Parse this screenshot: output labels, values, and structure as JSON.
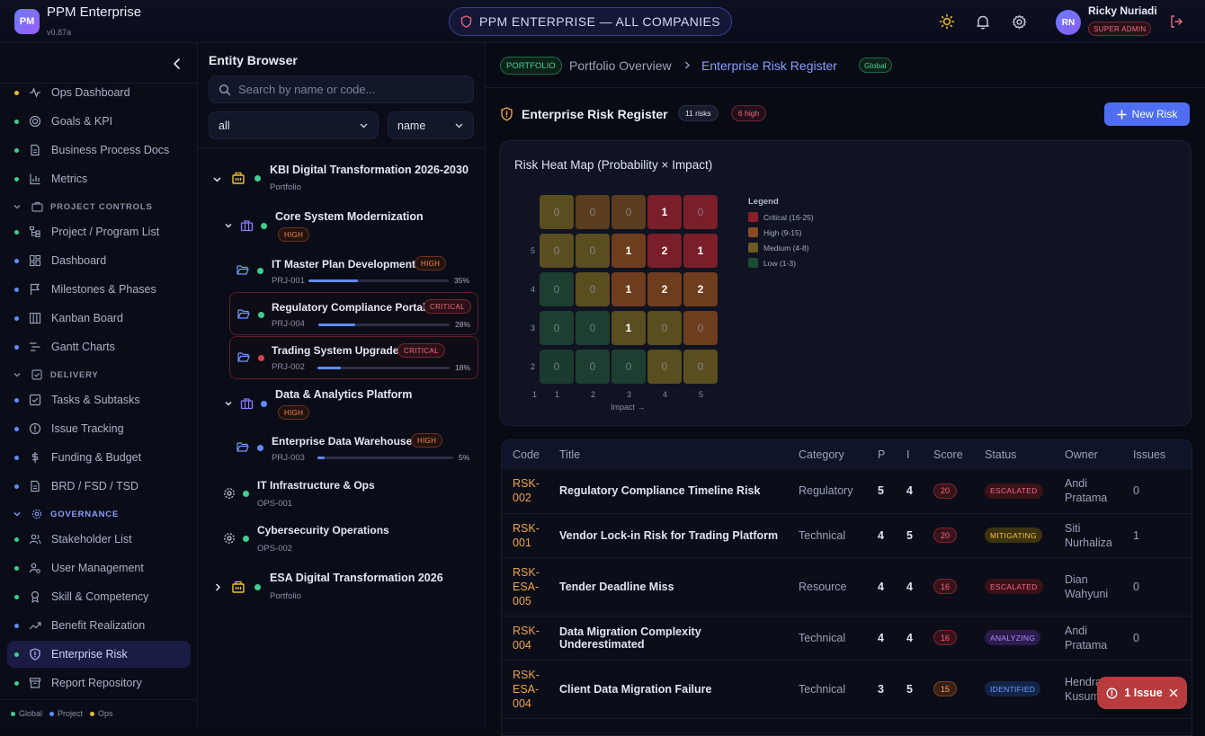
{
  "app": {
    "logo_text": "PM",
    "name": "PPM Enterprise",
    "version": "v0.87a"
  },
  "header": {
    "scope_label": "PPM ENTERPRISE — ALL COMPANIES",
    "user_initials": "RN",
    "user_name": "Ricky Nuriadi",
    "user_role": "SUPER ADMIN"
  },
  "sidebar": {
    "items": [
      {
        "label": "Ops Dashboard",
        "dot": "#e8b93b"
      },
      {
        "label": "Goals & KPI",
        "dot": "#3ecf8e"
      },
      {
        "label": "Business Process Docs",
        "dot": "#3ecf8e"
      },
      {
        "label": "Metrics",
        "dot": "#3ecf8e"
      }
    ],
    "sections": [
      {
        "label": "PROJECT CONTROLS"
      },
      {
        "label": "DELIVERY"
      },
      {
        "label": "GOVERNANCE"
      }
    ],
    "project_items": [
      {
        "label": "Project / Program List",
        "dot": "#3ecf8e"
      },
      {
        "label": "Dashboard",
        "dot": "#5e8cff"
      },
      {
        "label": "Milestones & Phases",
        "dot": "#5e8cff"
      },
      {
        "label": "Kanban Board",
        "dot": "#5e8cff"
      },
      {
        "label": "Gantt Charts",
        "dot": "#5e8cff"
      }
    ],
    "delivery_items": [
      {
        "label": "Tasks & Subtasks",
        "dot": "#5e8cff"
      },
      {
        "label": "Issue Tracking",
        "dot": "#5e8cff"
      },
      {
        "label": "Funding & Budget",
        "dot": "#5e8cff"
      },
      {
        "label": "BRD / FSD / TSD",
        "dot": "#5e8cff"
      }
    ],
    "governance_items": [
      {
        "label": "Stakeholder List",
        "dot": "#3ecf8e"
      },
      {
        "label": "User Management",
        "dot": "#3ecf8e"
      },
      {
        "label": "Skill & Competency",
        "dot": "#3ecf8e"
      },
      {
        "label": "Benefit Realization",
        "dot": "#5e8cff"
      },
      {
        "label": "Enterprise Risk",
        "dot": "#3ecf8e"
      },
      {
        "label": "Report Repository",
        "dot": "#3ecf8e"
      }
    ],
    "legend": {
      "global": "Global",
      "project": "Project",
      "ops": "Ops"
    }
  },
  "browser": {
    "title": "Entity Browser",
    "search_placeholder": "Search by name or code...",
    "filter_value": "all",
    "sort_value": "name",
    "tree": {
      "kbi": {
        "name": "KBI Digital Transformation 2026-2030",
        "sub": "Portfolio"
      },
      "core": {
        "name": "Core System Modernization",
        "badge": "HIGH"
      },
      "itmp": {
        "name": "IT Master Plan Development",
        "badge": "HIGH",
        "code": "PRJ-001",
        "pct": "35%",
        "progress": 0.35
      },
      "rcp": {
        "name": "Regulatory Compliance Portal",
        "badge": "CRITICAL",
        "code": "PRJ-004",
        "pct": "28%",
        "progress": 0.28
      },
      "tsu": {
        "name": "Trading System Upgrade",
        "badge": "CRITICAL",
        "code": "PRJ-002",
        "pct": "18%",
        "progress": 0.18
      },
      "dap": {
        "name": "Data & Analytics Platform",
        "badge": "HIGH"
      },
      "edw": {
        "name": "Enterprise Data Warehouse",
        "badge": "HIGH",
        "code": "PRJ-003",
        "pct": "5%",
        "progress": 0.05
      },
      "itio": {
        "name": "IT Infrastructure & Ops",
        "code": "OPS-001"
      },
      "cso": {
        "name": "Cybersecurity Operations",
        "code": "OPS-002"
      },
      "esa": {
        "name": "ESA Digital Transformation 2026",
        "sub": "Portfolio"
      }
    }
  },
  "main": {
    "breadcrumb": {
      "tag": "PORTFOLIO",
      "parent": "Portfolio Overview",
      "current": "Enterprise Risk Register",
      "scope": "Global"
    },
    "section_title": "Enterprise Risk Register",
    "count_risks": "11 risks",
    "count_high": "6 high",
    "new_risk_label": "New Risk",
    "heatmap": {
      "title": "Risk Heat Map (Probability × Impact)",
      "rows": [
        [
          "0",
          "0",
          "0",
          "1",
          "0"
        ],
        [
          "0",
          "0",
          "1",
          "2",
          "1"
        ],
        [
          "0",
          "0",
          "1",
          "2",
          "2"
        ],
        [
          "0",
          "0",
          "1",
          "0",
          "0"
        ],
        [
          "0",
          "0",
          "0",
          "0",
          "0"
        ]
      ],
      "row_labels": [
        "",
        "5",
        "4",
        "3",
        "2"
      ],
      "col_labels": [
        "1",
        "2",
        "3",
        "4",
        "5"
      ],
      "corner_label": "1",
      "x_axis_label": "Impact →",
      "legend_title": "Legend",
      "legend": [
        {
          "label": "Critical (16-25)",
          "color": "#8a1f2a"
        },
        {
          "label": "High (9-15)",
          "color": "#8a4a22"
        },
        {
          "label": "Medium (4-8)",
          "color": "#6b5a22"
        },
        {
          "label": "Low (1-3)",
          "color": "#1f4a35"
        }
      ]
    },
    "table": {
      "headers": [
        "Code",
        "Title",
        "Category",
        "P",
        "I",
        "Score",
        "Status",
        "Owner",
        "Issues"
      ],
      "rows": [
        {
          "code": "RSK-002",
          "title": "Regulatory Compliance Timeline Risk",
          "category": "Regulatory",
          "p": "5",
          "i": "4",
          "score": "20",
          "status": "ESCALATED",
          "owner": "Andi Pratama",
          "issues": "0"
        },
        {
          "code": "RSK-001",
          "title": "Vendor Lock-in Risk for Trading Platform",
          "category": "Technical",
          "p": "4",
          "i": "5",
          "score": "20",
          "status": "MITIGATING",
          "owner": "Siti Nurhaliza",
          "issues": "1"
        },
        {
          "code": "RSK-ESA-005",
          "title": "Tender Deadline Miss",
          "category": "Resource",
          "p": "4",
          "i": "4",
          "score": "16",
          "status": "ESCALATED",
          "owner": "Dian Wahyuni",
          "issues": "0"
        },
        {
          "code": "RSK-004",
          "title": "Data Migration Complexity Underestimated",
          "category": "Technical",
          "p": "4",
          "i": "4",
          "score": "16",
          "status": "ANALYZING",
          "owner": "Andi Pratama",
          "issues": "0"
        },
        {
          "code": "RSK-ESA-004",
          "title": "Client Data Migration Failure",
          "category": "Technical",
          "p": "3",
          "i": "5",
          "score": "15",
          "status": "IDENTIFIED",
          "owner": "Hendra Kusuma",
          "issues": ""
        }
      ]
    }
  },
  "issue_button": {
    "label": "1 Issue"
  }
}
